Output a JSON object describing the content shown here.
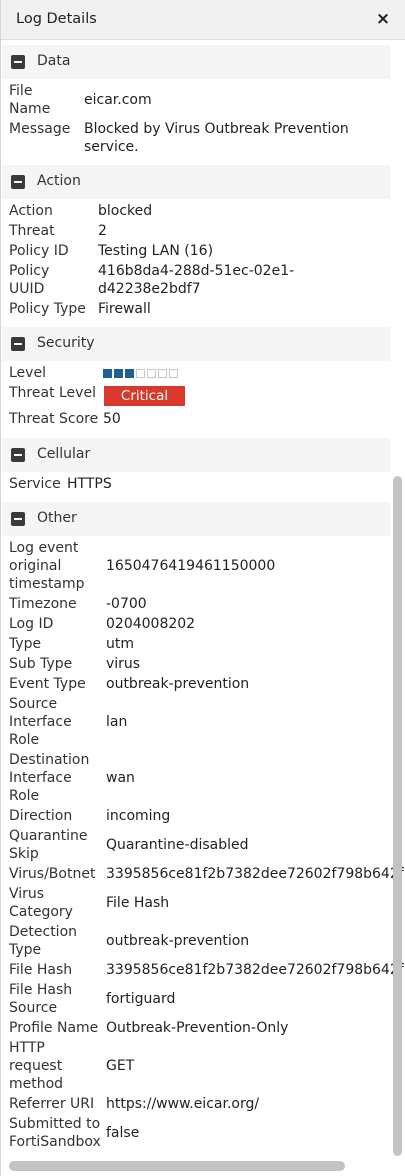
{
  "header": {
    "title": "Log Details",
    "close_icon": "×"
  },
  "sections": {
    "data": {
      "title": "Data",
      "rows": {
        "file_name": {
          "label": "File Name",
          "value": "eicar.com"
        },
        "message": {
          "label": "Message",
          "value": "Blocked by Virus Outbreak Prevention service."
        }
      }
    },
    "action": {
      "title": "Action",
      "rows": {
        "action": {
          "label": "Action",
          "value": "blocked"
        },
        "threat": {
          "label": "Threat",
          "value": "2"
        },
        "policy_id": {
          "label": "Policy ID",
          "value": "Testing LAN (16)"
        },
        "policy_uuid": {
          "label": "Policy UUID",
          "value": "416b8da4-288d-51ec-02e1-d42238e2bdf7"
        },
        "policy_type": {
          "label": "Policy Type",
          "value": "Firewall"
        }
      }
    },
    "security": {
      "title": "Security",
      "level": {
        "label": "Level",
        "filled": 3,
        "total": 7
      },
      "threat_level": {
        "label": "Threat Level",
        "value": "Critical",
        "color": "#d9392c"
      },
      "threat_score": {
        "label": "Threat Score",
        "value": "50"
      }
    },
    "cellular": {
      "title": "Cellular",
      "rows": {
        "service": {
          "label": "Service",
          "value": "HTTPS"
        }
      }
    },
    "other": {
      "title": "Other",
      "rows": {
        "log_event_ts": {
          "label": "Log event original timestamp",
          "value": "1650476419461150000"
        },
        "timezone": {
          "label": "Timezone",
          "value": "-0700"
        },
        "log_id": {
          "label": "Log ID",
          "value": "0204008202"
        },
        "type": {
          "label": "Type",
          "value": "utm"
        },
        "sub_type": {
          "label": "Sub Type",
          "value": "virus"
        },
        "event_type": {
          "label": "Event Type",
          "value": "outbreak-prevention"
        },
        "src_if_role": {
          "label": "Source Interface Role",
          "value": "lan"
        },
        "dst_if_role": {
          "label": "Destination Interface Role",
          "value": "wan"
        },
        "direction": {
          "label": "Direction",
          "value": "incoming"
        },
        "quarantine_skip": {
          "label": "Quarantine Skip",
          "value": "Quarantine-disabled"
        },
        "virus_botnet": {
          "label": "Virus/Botnet",
          "value": "3395856ce81f2b7382dee72602f798b642f"
        },
        "virus_category": {
          "label": "Virus Category",
          "value": "File Hash"
        },
        "detection_type": {
          "label": "Detection Type",
          "value": "outbreak-prevention"
        },
        "file_hash": {
          "label": "File Hash",
          "value": "3395856ce81f2b7382dee72602f798b642f"
        },
        "file_hash_source": {
          "label": "File Hash Source",
          "value": "fortiguard"
        },
        "profile_name": {
          "label": "Profile Name",
          "value": "Outbreak-Prevention-Only"
        },
        "http_method": {
          "label": "HTTP request method",
          "value": "GET"
        },
        "referrer_uri": {
          "label": "Referrer URI",
          "value": "https://www.eicar.org/"
        },
        "submitted_fsb": {
          "label": "Submitted to FortiSandbox",
          "value": "false"
        }
      }
    }
  },
  "colors": {
    "header_bg": "#f1f1f1",
    "section_bg": "#f5f5f5",
    "level_fill": "#1f5f96",
    "critical": "#d9392c"
  }
}
